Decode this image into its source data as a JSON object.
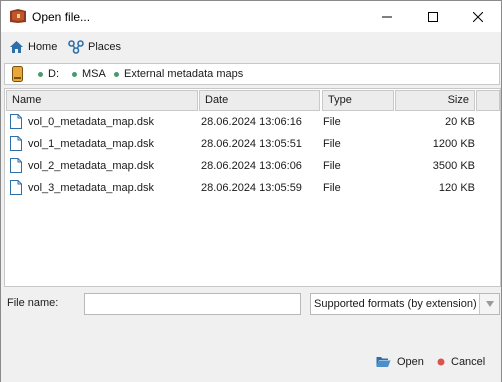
{
  "window": {
    "title": "Open file...",
    "minimize_icon": "minimize-icon",
    "maximize_icon": "maximize-icon",
    "close_icon": "close-icon"
  },
  "toolbar": {
    "home_label": "Home",
    "places_label": "Places"
  },
  "breadcrumb": {
    "items": [
      {
        "label": "D:"
      },
      {
        "label": "MSA"
      },
      {
        "label": "External metadata maps"
      }
    ]
  },
  "file_list": {
    "columns": [
      {
        "label": "Name"
      },
      {
        "label": "Date"
      },
      {
        "label": "Type"
      },
      {
        "label": "Size"
      }
    ],
    "rows": [
      {
        "name": "vol_0_metadata_map.dsk",
        "date": "28.06.2024 13:06:16",
        "type": "File",
        "size": "20 KB"
      },
      {
        "name": "vol_1_metadata_map.dsk",
        "date": "28.06.2024 13:05:51",
        "type": "File",
        "size": "1200 KB"
      },
      {
        "name": "vol_2_metadata_map.dsk",
        "date": "28.06.2024 13:06:06",
        "type": "File",
        "size": "3500 KB"
      },
      {
        "name": "vol_3_metadata_map.dsk",
        "date": "28.06.2024 13:05:59",
        "type": "File",
        "size": "120 KB"
      }
    ]
  },
  "bottom": {
    "file_name_label": "File name:",
    "file_name_value": "",
    "format_selected": "Supported formats (by extension)"
  },
  "actions": {
    "open_label": "Open",
    "cancel_label": "Cancel"
  },
  "colors": {
    "accent_green": "#4a9a6a",
    "cancel_red": "#d9534f",
    "folder_blue": "#2d6fa8"
  }
}
